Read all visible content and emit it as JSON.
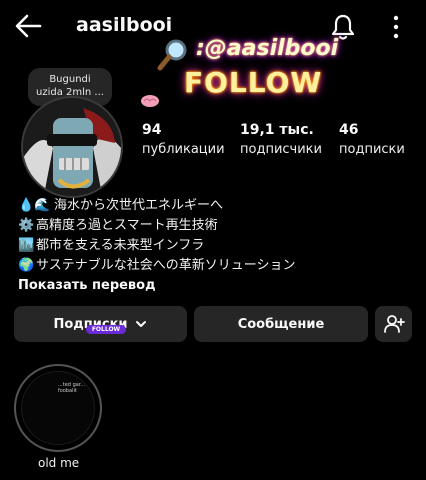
{
  "header": {
    "username": "aasilbooi"
  },
  "sticker": {
    "handle": ":@aasilbooi",
    "follow": "FOLLOW"
  },
  "note": {
    "text_line1": "Bugundi",
    "text_line2": "uzida 2mln ..."
  },
  "stats": [
    {
      "value": "94",
      "label": "публикации"
    },
    {
      "value": "19,1 тыс.",
      "label": "подписчики"
    },
    {
      "value": "46",
      "label": "подписки"
    }
  ],
  "bio": {
    "lines": [
      {
        "emoji": "💧🌊",
        "text": "海水から次世代エネルギーへ"
      },
      {
        "emoji": "⚙️",
        "text": "高精度ろ過とスマート再生技術"
      },
      {
        "emoji": "🏙️",
        "text": "都市を支える未来型インフラ"
      },
      {
        "emoji": "🌍",
        "text": "サステナブルな社会への革新ソリューション"
      }
    ],
    "translate": "Показать перевод"
  },
  "actions": {
    "following_label": "Подписки",
    "following_badge": "FOLLOW",
    "message_label": "Сообщение"
  },
  "highlights": [
    {
      "caption": "...ted gar...",
      "caption2": "foobalit",
      "label": "old me"
    }
  ],
  "colors": {
    "background": "#000000",
    "button": "#262626",
    "text": "#f5f5f5",
    "sticker_glow": "#ff2bd6",
    "badge": "#6b2bd9"
  }
}
